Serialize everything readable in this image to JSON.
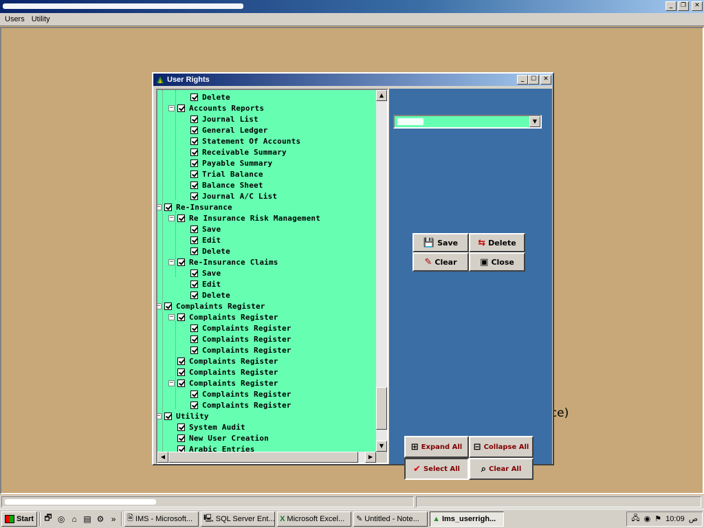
{
  "menubar": {
    "items": [
      "Users",
      "Utility"
    ]
  },
  "window_buttons": {
    "minimize": "_",
    "restore": "❐",
    "close": "✕"
  },
  "background": {
    "partial_text": "nce)"
  },
  "dialog": {
    "title": "User Rights",
    "buttons": {
      "save": "Save",
      "delete": "Delete",
      "clear": "Clear",
      "close": "Close",
      "expand_all": "Expand All",
      "collapse_all": "Collapse All",
      "select_all": "Select All",
      "clear_all": "Clear All"
    },
    "tree": [
      {
        "label": "Delete",
        "level": 2,
        "expander": ""
      },
      {
        "label": "Accounts Reports",
        "level": 1,
        "expander": "−"
      },
      {
        "label": "Journal List",
        "level": 2,
        "expander": ""
      },
      {
        "label": "General Ledger",
        "level": 2,
        "expander": ""
      },
      {
        "label": "Statement Of Accounts",
        "level": 2,
        "expander": ""
      },
      {
        "label": "Receivable Summary",
        "level": 2,
        "expander": ""
      },
      {
        "label": "Payable Summary",
        "level": 2,
        "expander": ""
      },
      {
        "label": "Trial Balance",
        "level": 2,
        "expander": ""
      },
      {
        "label": "Balance Sheet",
        "level": 2,
        "expander": ""
      },
      {
        "label": "Journal A/C List",
        "level": 2,
        "expander": ""
      },
      {
        "label": "Re-Insurance",
        "level": 0,
        "expander": "−"
      },
      {
        "label": "Re Insurance Risk Management",
        "level": 1,
        "expander": "−"
      },
      {
        "label": "Save",
        "level": 2,
        "expander": ""
      },
      {
        "label": "Edit",
        "level": 2,
        "expander": ""
      },
      {
        "label": "Delete",
        "level": 2,
        "expander": ""
      },
      {
        "label": "Re-Insurance Claims",
        "level": 1,
        "expander": "−"
      },
      {
        "label": "Save",
        "level": 2,
        "expander": ""
      },
      {
        "label": "Edit",
        "level": 2,
        "expander": ""
      },
      {
        "label": "Delete",
        "level": 2,
        "expander": ""
      },
      {
        "label": "Complaints Register",
        "level": 0,
        "expander": "−"
      },
      {
        "label": "Complaints Register",
        "level": 1,
        "expander": "−"
      },
      {
        "label": "Complaints Register",
        "level": 2,
        "expander": ""
      },
      {
        "label": "Complaints Register",
        "level": 2,
        "expander": ""
      },
      {
        "label": "Complaints Register",
        "level": 2,
        "expander": ""
      },
      {
        "label": "Complaints Register",
        "level": 1,
        "expander": ""
      },
      {
        "label": "Complaints Register",
        "level": 1,
        "expander": ""
      },
      {
        "label": "Complaints Register",
        "level": 1,
        "expander": "−"
      },
      {
        "label": "Complaints Register",
        "level": 2,
        "expander": ""
      },
      {
        "label": "Complaints Register",
        "level": 2,
        "expander": ""
      },
      {
        "label": "Utility",
        "level": 0,
        "expander": "−"
      },
      {
        "label": "System Audit",
        "level": 1,
        "expander": ""
      },
      {
        "label": "New User Creation",
        "level": 1,
        "expander": ""
      },
      {
        "label": "Arabic Entries",
        "level": 1,
        "expander": ""
      }
    ]
  },
  "taskbar": {
    "start_label": "Start",
    "more": "»",
    "tasks": [
      {
        "label": "IMS - Microsoft...",
        "active": false
      },
      {
        "label": "SQL Server Ent...",
        "active": false
      },
      {
        "label": "Microsoft Excel...",
        "active": false
      },
      {
        "label": "Untitled - Note...",
        "active": false
      },
      {
        "label": "Ims_userrigh...",
        "active": true
      }
    ],
    "tray": {
      "time": "10:09",
      "indicator": "ص"
    }
  },
  "colors": {
    "tree_bg": "#66ffb2",
    "panel_bg": "#3a6ea5",
    "desktop_bg": "#c8a878"
  }
}
